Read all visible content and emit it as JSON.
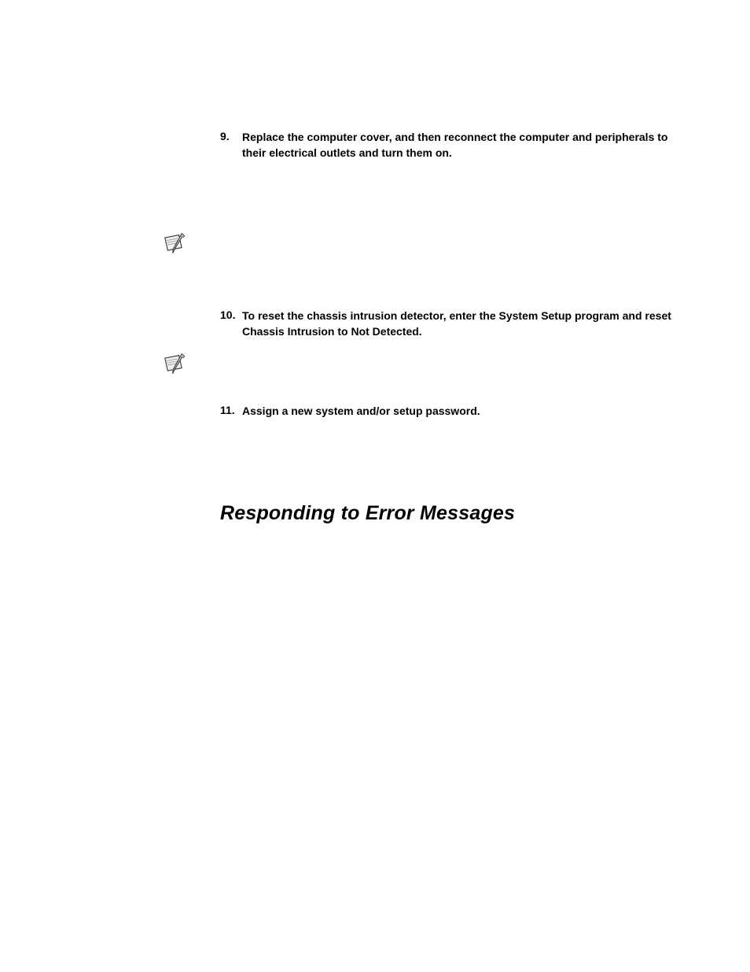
{
  "steps": {
    "item9": {
      "number": "9.",
      "text": "Replace the computer cover, and then reconnect the computer and peripherals to their electrical outlets and turn them on."
    },
    "item10": {
      "number": "10.",
      "text": "To reset the chassis intrusion detector, enter the System Setup program and reset Chassis Intrusion to Not Detected."
    },
    "item11": {
      "number": "11.",
      "text": "Assign a new system and/or setup password."
    }
  },
  "heading": "Responding to Error Messages"
}
